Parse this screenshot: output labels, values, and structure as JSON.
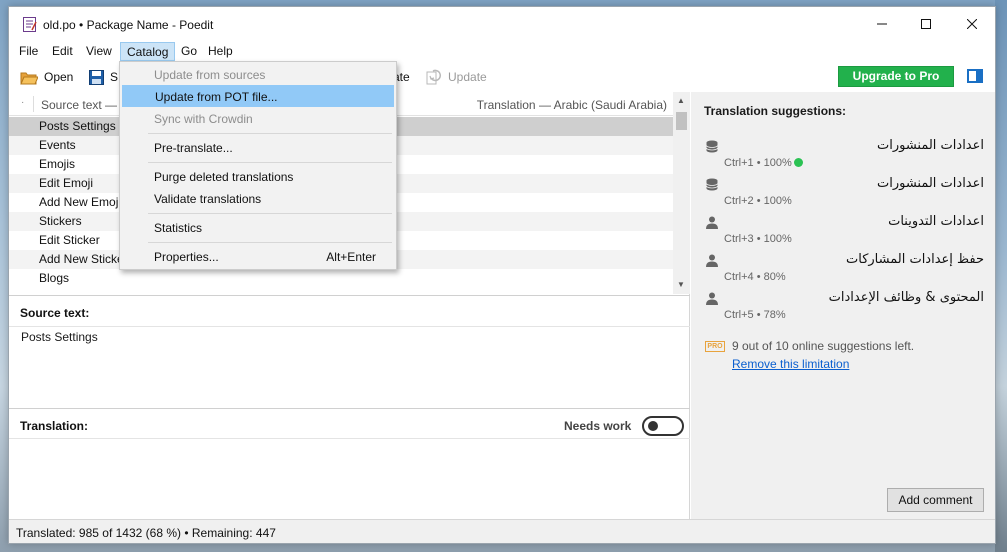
{
  "window": {
    "title": "old.po • Package Name - Poedit"
  },
  "menubar": {
    "items": [
      "File",
      "Edit",
      "View",
      "Catalog",
      "Go",
      "Help"
    ]
  },
  "toolbar": {
    "open_label": "Open",
    "save_label_partial": "S",
    "validate_label_partial": "ate",
    "update_label": "Update",
    "upgrade_label": "Upgrade to Pro"
  },
  "catalog_menu": {
    "items": [
      {
        "label": "Update from sources",
        "enabled": false
      },
      {
        "label": "Update from POT file...",
        "enabled": true,
        "highlighted": true
      },
      {
        "label": "Sync with Crowdin",
        "enabled": false
      },
      {
        "label": "Pre-translate...",
        "enabled": true
      },
      {
        "label": "Purge deleted translations",
        "enabled": true
      },
      {
        "label": "Validate translations",
        "enabled": true
      },
      {
        "label": "Statistics",
        "enabled": true
      },
      {
        "label": "Properties...",
        "enabled": true,
        "shortcut": "Alt+Enter"
      }
    ]
  },
  "list": {
    "header_dot": "·",
    "source_header": "Source text —",
    "translation_header": "Translation — Arabic (Saudi Arabia)",
    "rows": [
      "Posts Settings",
      "Events",
      "Emojis",
      "Edit Emoji",
      "Add New Emoji",
      "Stickers",
      "Edit Sticker",
      "Add New Sticker",
      "Blogs"
    ]
  },
  "editor": {
    "source_label": "Source text:",
    "source_value": "Posts Settings",
    "translation_label": "Translation:",
    "needs_work_label": "Needs work"
  },
  "suggestions": {
    "title": "Translation suggestions:",
    "items": [
      {
        "text": "اعدادات المنشورات",
        "meta": "Ctrl+1 • 100%",
        "icon": "database-icon",
        "verified": true
      },
      {
        "text": "اعدادات المنشورات",
        "meta": "Ctrl+2 • 100%",
        "icon": "database-icon",
        "verified": false
      },
      {
        "text": "اعدادات التدوينات",
        "meta": "Ctrl+3 • 100%",
        "icon": "person-icon",
        "verified": false
      },
      {
        "text": "حفظ إعدادات المشاركات",
        "meta": "Ctrl+4 • 80%",
        "icon": "person-icon",
        "verified": false
      },
      {
        "text": "المحتوى & وظائف الإعدادات",
        "meta": "Ctrl+5 • 78%",
        "icon": "person-icon",
        "verified": false
      }
    ],
    "pro_badge": "PRO",
    "limit_text": "9 out of 10 online suggestions left.",
    "limit_link": "Remove this limitation",
    "add_comment_label": "Add comment"
  },
  "status": {
    "text": "Translated: 985 of 1432 (68 %)  •  Remaining: 447"
  },
  "colors": {
    "upgrade_green": "#22b14c",
    "menu_highlight": "#91c9f7",
    "link_blue": "#0b5fcf",
    "pro_orange": "#e8a33d"
  }
}
